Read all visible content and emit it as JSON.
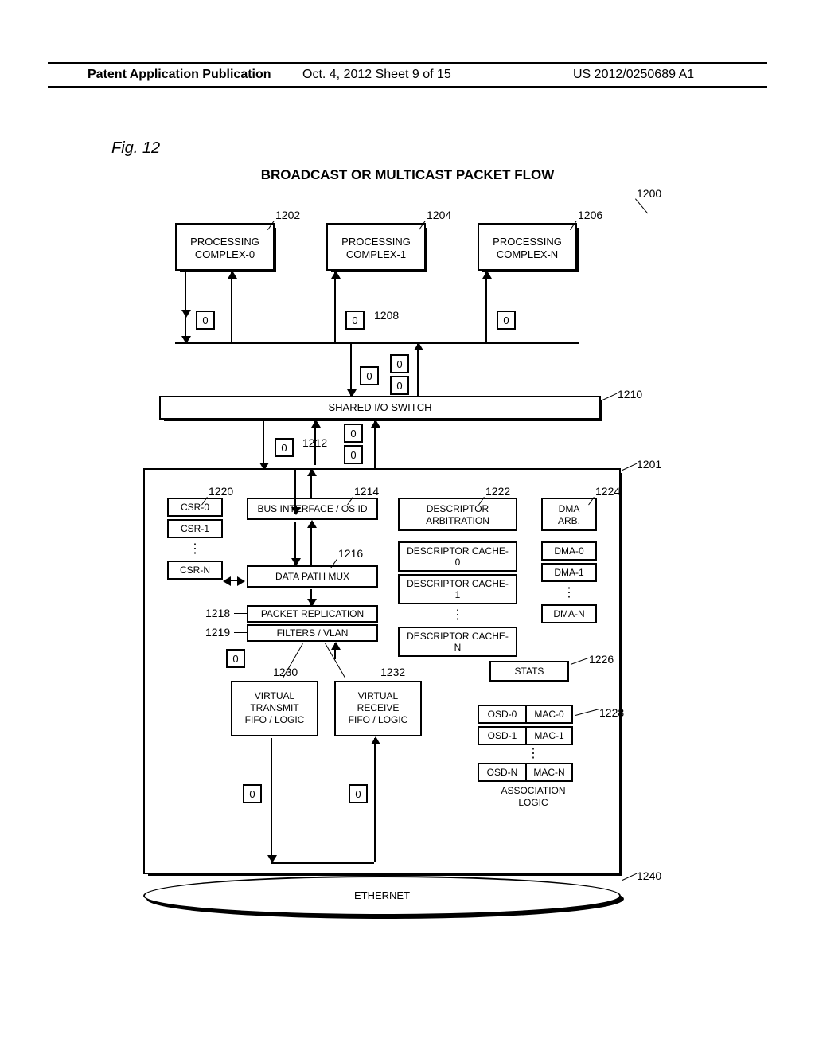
{
  "header": {
    "left": "Patent Application Publication",
    "center": "Oct. 4, 2012  Sheet 9 of 15",
    "right": "US 2012/0250689 A1"
  },
  "fig_label": "Fig. 12",
  "title": "BROADCAST OR MULTICAST PACKET FLOW",
  "refs": {
    "r1200": "1200",
    "r1201": "1201",
    "r1202": "1202",
    "r1204": "1204",
    "r1206": "1206",
    "r1208": "1208",
    "r1210": "1210",
    "r1212": "1212",
    "r1214": "1214",
    "r1216": "1216",
    "r1218": "1218",
    "r1219": "1219",
    "r1220": "1220",
    "r1222": "1222",
    "r1224": "1224",
    "r1226": "1226",
    "r1228": "1228",
    "r1230": "1230",
    "r1232": "1232",
    "r1240": "1240"
  },
  "packet": "0",
  "blocks": {
    "pc0": "PROCESSING\nCOMPLEX-0",
    "pc1": "PROCESSING\nCOMPLEX-1",
    "pcn": "PROCESSING\nCOMPLEX-N",
    "switch": "SHARED I/O SWITCH",
    "bus": "BUS INTERFACE / OS ID",
    "mux": "DATA PATH MUX",
    "rep": "PACKET REPLICATION",
    "filt": "FILTERS / VLAN",
    "vtx": "VIRTUAL\nTRANSMIT\nFIFO / LOGIC",
    "vrx": "VIRTUAL\nRECEIVE\nFIFO / LOGIC",
    "desc_arb": "DESCRIPTOR\nARBITRATION",
    "dc0": "DESCRIPTOR CACHE-0",
    "dc1": "DESCRIPTOR CACHE-1",
    "dcn": "DESCRIPTOR CACHE-N",
    "dma_arb": "DMA\nARB.",
    "dma0": "DMA-0",
    "dma1": "DMA-1",
    "dman": "DMA-N",
    "csr0": "CSR-0",
    "csr1": "CSR-1",
    "csrn": "CSR-N",
    "stats": "STATS",
    "osd0": "OSD-0",
    "osd1": "OSD-1",
    "osdn": "OSD-N",
    "mac0": "MAC-0",
    "mac1": "MAC-1",
    "macn": "MAC-N",
    "assoc": "ASSOCIATION\nLOGIC",
    "eth": "ETHERNET"
  }
}
